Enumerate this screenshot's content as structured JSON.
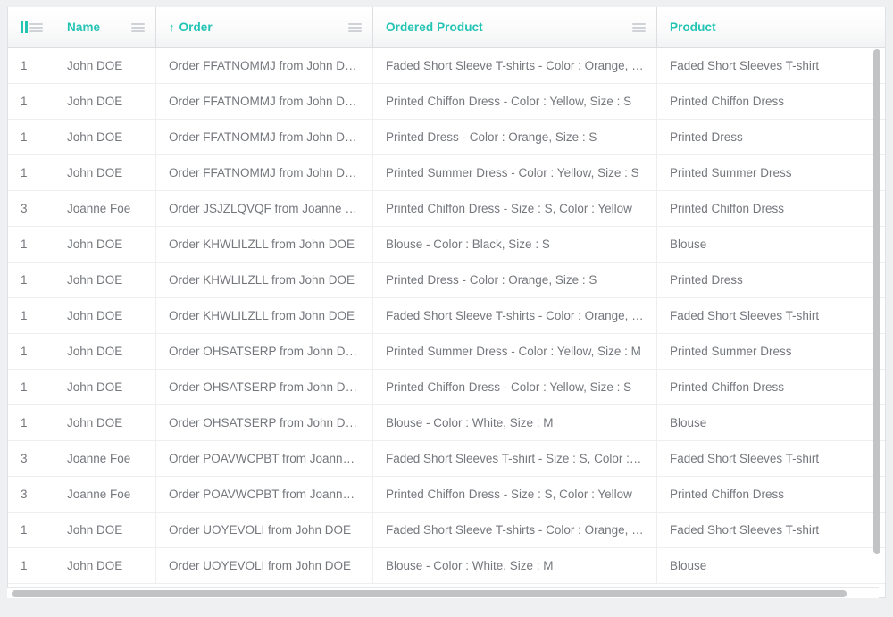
{
  "grid": {
    "columns": [
      {
        "key": "qty",
        "label": "",
        "icon": "column-group-icon",
        "menu_icon": "hamburger-icon",
        "sorted": false,
        "sort_arrow": ""
      },
      {
        "key": "name",
        "label": "Name",
        "icon": "",
        "menu_icon": "hamburger-icon",
        "sorted": false,
        "sort_arrow": ""
      },
      {
        "key": "order",
        "label": "Order",
        "icon": "",
        "menu_icon": "hamburger-icon",
        "sorted": true,
        "sort_arrow": "↑"
      },
      {
        "key": "ordered_product",
        "label": "Ordered Product",
        "icon": "",
        "menu_icon": "hamburger-icon",
        "sorted": false,
        "sort_arrow": ""
      },
      {
        "key": "product",
        "label": "Product",
        "icon": "",
        "menu_icon": "",
        "sorted": false,
        "sort_arrow": ""
      }
    ],
    "rows": [
      {
        "qty": "1",
        "name": "John DOE",
        "order": "Order FFATNOMMJ from John DOE",
        "ordered_product": "Faded Short Sleeve T-shirts - Color : Orange, Si…",
        "product": "Faded Short Sleeves T-shirt"
      },
      {
        "qty": "1",
        "name": "John DOE",
        "order": "Order FFATNOMMJ from John DOE",
        "ordered_product": "Printed Chiffon Dress - Color : Yellow, Size : S",
        "product": "Printed Chiffon Dress"
      },
      {
        "qty": "1",
        "name": "John DOE",
        "order": "Order FFATNOMMJ from John DOE",
        "ordered_product": "Printed Dress - Color : Orange, Size : S",
        "product": "Printed Dress"
      },
      {
        "qty": "1",
        "name": "John DOE",
        "order": "Order FFATNOMMJ from John DOE",
        "ordered_product": "Printed Summer Dress - Color : Yellow, Size : S",
        "product": "Printed Summer Dress"
      },
      {
        "qty": "3",
        "name": "Joanne Foe",
        "order": "Order JSJZLQVQF from Joanne Foe",
        "ordered_product": "Printed Chiffon Dress - Size : S, Color : Yellow",
        "product": "Printed Chiffon Dress"
      },
      {
        "qty": "1",
        "name": "John DOE",
        "order": "Order KHWLILZLL from John DOE",
        "ordered_product": "Blouse - Color : Black, Size : S",
        "product": "Blouse"
      },
      {
        "qty": "1",
        "name": "John DOE",
        "order": "Order KHWLILZLL from John DOE",
        "ordered_product": "Printed Dress - Color : Orange, Size : S",
        "product": "Printed Dress"
      },
      {
        "qty": "1",
        "name": "John DOE",
        "order": "Order KHWLILZLL from John DOE",
        "ordered_product": "Faded Short Sleeve T-shirts - Color : Orange, Si…",
        "product": "Faded Short Sleeves T-shirt"
      },
      {
        "qty": "1",
        "name": "John DOE",
        "order": "Order OHSATSERP from John DOE",
        "ordered_product": "Printed Summer Dress - Color : Yellow, Size : M",
        "product": "Printed Summer Dress"
      },
      {
        "qty": "1",
        "name": "John DOE",
        "order": "Order OHSATSERP from John DOE",
        "ordered_product": "Printed Chiffon Dress - Color : Yellow, Size : S",
        "product": "Printed Chiffon Dress"
      },
      {
        "qty": "1",
        "name": "John DOE",
        "order": "Order OHSATSERP from John DOE",
        "ordered_product": "Blouse - Color : White, Size : M",
        "product": "Blouse"
      },
      {
        "qty": "3",
        "name": "Joanne Foe",
        "order": "Order POAVWCPBT from Joanne F…",
        "ordered_product": "Faded Short Sleeves T-shirt - Size : S, Color : Or…",
        "product": "Faded Short Sleeves T-shirt"
      },
      {
        "qty": "3",
        "name": "Joanne Foe",
        "order": "Order POAVWCPBT from Joanne F…",
        "ordered_product": "Printed Chiffon Dress - Size : S, Color : Yellow",
        "product": "Printed Chiffon Dress"
      },
      {
        "qty": "1",
        "name": "John DOE",
        "order": "Order UOYEVOLI from John DOE",
        "ordered_product": "Faded Short Sleeve T-shirts - Color : Orange, Si…",
        "product": "Faded Short Sleeves T-shirt"
      },
      {
        "qty": "1",
        "name": "John DOE",
        "order": "Order UOYEVOLI from John DOE",
        "ordered_product": "Blouse - Color : White, Size : M",
        "product": "Blouse"
      }
    ]
  },
  "colors": {
    "header_text": "#23c4b4",
    "body_text": "#74777c",
    "page_background": "#eff0f2",
    "grid_line": "#eceef0",
    "scrollbar_thumb": "#c2c3c5"
  }
}
